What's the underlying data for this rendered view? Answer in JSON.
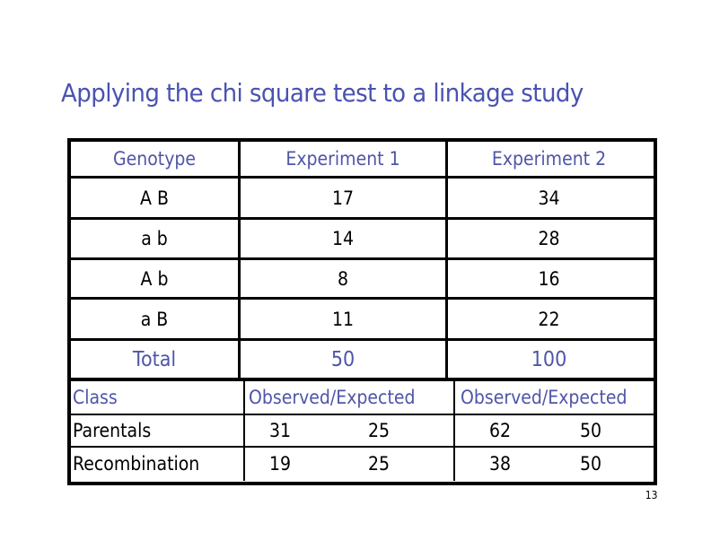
{
  "title": "Applying the chi square test to a linkage study",
  "colors": {
    "title": "#4a52b0",
    "header_text": "#4f55a8",
    "body_text": "#000000",
    "border": "#000000"
  },
  "genotype_table": {
    "headers": [
      "Genotype",
      "Experiment 1",
      "Experiment 2"
    ],
    "rows": [
      {
        "genotype": "A B",
        "exp1": "17",
        "exp2": "34"
      },
      {
        "genotype": "a b",
        "exp1": "14",
        "exp2": "28"
      },
      {
        "genotype": "A b",
        "exp1": "8",
        "exp2": "16"
      },
      {
        "genotype": "a B",
        "exp1": "11",
        "exp2": "22"
      }
    ],
    "total": {
      "label": "Total",
      "exp1": "50",
      "exp2": "100"
    }
  },
  "class_table": {
    "headers": [
      "Class",
      "Observed/Expected",
      "Observed/Expected"
    ],
    "rows": [
      {
        "class": "Parentals",
        "exp1_observed": "31",
        "exp1_expected": "25",
        "exp2_observed": "62",
        "exp2_expected": "50"
      },
      {
        "class": "Recombination",
        "exp1_observed": "19",
        "exp1_expected": "25",
        "exp2_observed": "38",
        "exp2_expected": "50"
      }
    ]
  },
  "page_number": "13"
}
